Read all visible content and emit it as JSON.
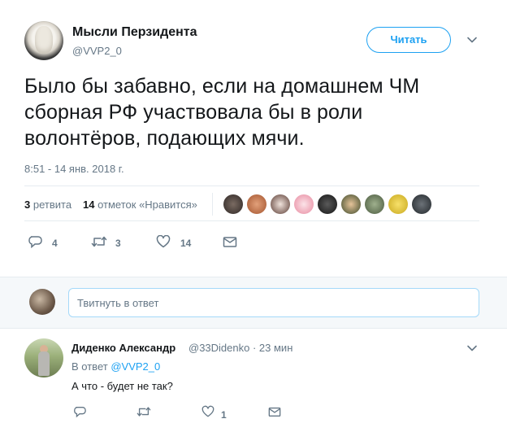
{
  "author": {
    "name": "Мысли Перзидента",
    "handle": "@VVP2_0",
    "follow_label": "Читать"
  },
  "tweet": {
    "text": "Было бы забавно, если на домашнем ЧМ сборная РФ участвовала бы в роли волонтёров, подающих мячи.",
    "timestamp": "8:51 - 14 янв. 2018 г."
  },
  "stats": {
    "retweets_count": "3",
    "retweets_label": "ретвита",
    "likes_count": "14",
    "likes_label": "отметок «Нравится»"
  },
  "actions": {
    "replies": "4",
    "retweets": "3",
    "likes": "14"
  },
  "reply_box": {
    "placeholder": "Твитнуть в ответ"
  },
  "reply": {
    "name": "Диденко Александр",
    "handle": "@33Didenko",
    "time": "· 23 мин",
    "in_reply_prefix": "В ответ",
    "in_reply_handle": "@VVP2_0",
    "text": "А что - будет не так?",
    "replies": "",
    "retweets": "",
    "likes": "1"
  },
  "colors": {
    "accent": "#1da1f2",
    "muted": "#657786",
    "text": "#14171a",
    "border": "#e6ecf0"
  }
}
